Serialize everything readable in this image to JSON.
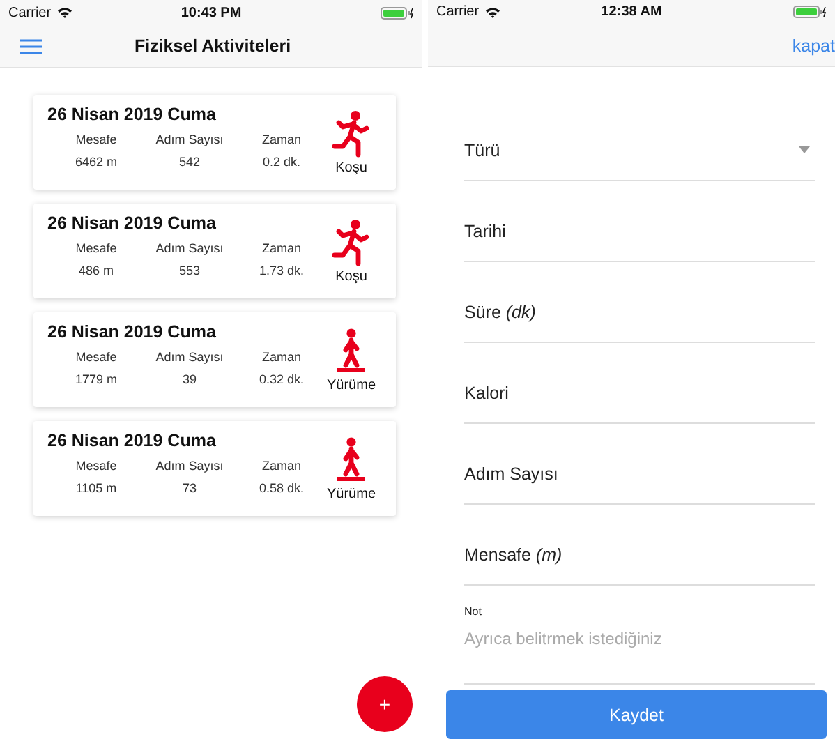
{
  "screens": [
    {
      "status_bar": {
        "carrier": "Carrier",
        "time": "10:43 PM"
      },
      "nav": {
        "title": "Fiziksel Aktiviteleri"
      },
      "activities": [
        {
          "date": "26 Nisan 2019 Cuma",
          "headers": [
            "Mesafe",
            "Adım Sayısı",
            "Zaman"
          ],
          "values": [
            "6462 m",
            "542",
            "0.2 dk."
          ],
          "kind": "run",
          "label": "Koşu"
        },
        {
          "date": "26 Nisan 2019 Cuma",
          "headers": [
            "Mesafe",
            "Adım Sayısı",
            "Zaman"
          ],
          "values": [
            "486 m",
            "553",
            "1.73 dk."
          ],
          "kind": "run",
          "label": "Koşu"
        },
        {
          "date": "26 Nisan 2019 Cuma",
          "headers": [
            "Mesafe",
            "Adım Sayısı",
            "Zaman"
          ],
          "values": [
            "1779 m",
            "39",
            "0.32 dk."
          ],
          "kind": "walk",
          "label": "Yürüme"
        },
        {
          "date": "26 Nisan 2019 Cuma",
          "headers": [
            "Mesafe",
            "Adım Sayısı",
            "Zaman"
          ],
          "values": [
            "1105 m",
            "73",
            "0.58 dk."
          ],
          "kind": "walk",
          "label": "Yürüme"
        }
      ],
      "fab": {
        "label": "+"
      }
    },
    {
      "status_bar": {
        "carrier": "Carrier",
        "time": "12:38 AM"
      },
      "nav": {
        "action": "kapat"
      },
      "fields": [
        {
          "kind": "select",
          "label": "Türü"
        },
        {
          "kind": "text",
          "label": "Tarihi"
        },
        {
          "kind": "text",
          "label": "Süre *(dk)*"
        },
        {
          "kind": "text",
          "label": "Kalori"
        },
        {
          "kind": "text",
          "label": "Adım Sayısı"
        },
        {
          "kind": "text",
          "label": "Mensafe *(m)*"
        },
        {
          "kind": "textarea",
          "label": "Not",
          "placeholder": "Ayrıca belitrmek istediğiniz"
        }
      ],
      "submit": "Kaydet"
    }
  ]
}
